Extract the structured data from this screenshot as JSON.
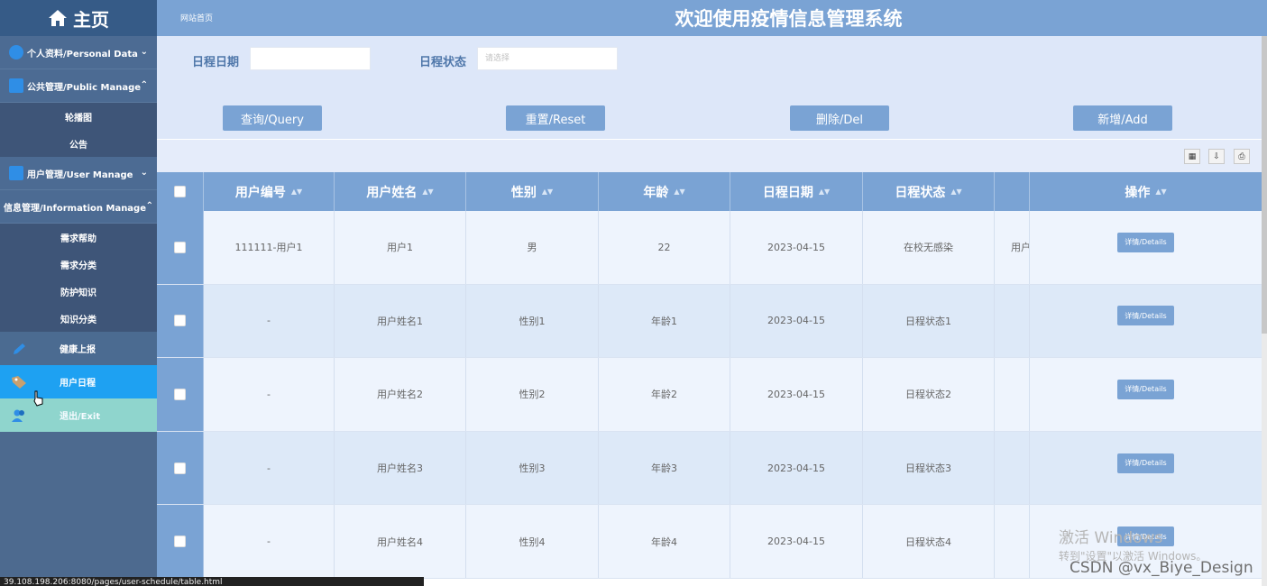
{
  "sidebar": {
    "brand": "主页",
    "menus": [
      {
        "label": "个人资料/Personal Data",
        "chevron": "⌄",
        "icon": "user-circle-icon"
      },
      {
        "label": "公共管理/Public Manage",
        "chevron": "⌃",
        "icon": "monitor-icon",
        "items": [
          "轮播图",
          "公告"
        ]
      },
      {
        "label": "用户管理/User Manage",
        "chevron": "⌄",
        "icon": "id-card-icon"
      },
      {
        "label": "信息管理/Information Manage",
        "chevron": "⌃",
        "icon": "info-icon",
        "items": [
          "需求帮助",
          "需求分类",
          "防护知识",
          "知识分类"
        ]
      }
    ],
    "health": "健康上报",
    "schedule": "用户日程",
    "exit": "退出/Exit"
  },
  "header": {
    "breadcrumb": "网站首页",
    "title": "欢迎使用疫情信息管理系统"
  },
  "search": {
    "date_label": "日程日期",
    "date_value": "",
    "status_label": "日程状态",
    "status_placeholder": "请选择"
  },
  "buttons": {
    "query": "查询/Query",
    "reset": "重置/Reset",
    "delete": "删除/Del",
    "add": "新增/Add"
  },
  "table": {
    "columns": [
      "用户编号",
      "用户姓名",
      "性别",
      "年龄",
      "日程日期",
      "日程状态",
      "",
      "操作"
    ],
    "rows": [
      [
        "111111-用户1",
        "用户1",
        "男",
        "22",
        "2023-04-15",
        "在校无感染",
        "用户"
      ],
      [
        "-",
        "用户姓名1",
        "性别1",
        "年龄1",
        "2023-04-15",
        "日程状态1",
        ""
      ],
      [
        "-",
        "用户姓名2",
        "性别2",
        "年龄2",
        "2023-04-15",
        "日程状态2",
        ""
      ],
      [
        "-",
        "用户姓名3",
        "性别3",
        "年龄3",
        "2023-04-15",
        "日程状态3",
        ""
      ],
      [
        "-",
        "用户姓名4",
        "性别4",
        "年龄4",
        "2023-04-15",
        "日程状态4",
        ""
      ]
    ],
    "details_label": "详情/Details"
  },
  "watermark": {
    "activate": "激活 Windows",
    "activate_hint": "转到\"设置\"以激活 Windows。",
    "csdn": "CSDN @vx_Biye_Design"
  },
  "statusbar": {
    "url": "39.108.198.206:8080/pages/user-schedule/table.html"
  },
  "colors": {
    "sidebar": "#4d6a8f",
    "header": "#7aa3d4",
    "active": "#1ea1f2",
    "exit": "#8fd5cd"
  }
}
